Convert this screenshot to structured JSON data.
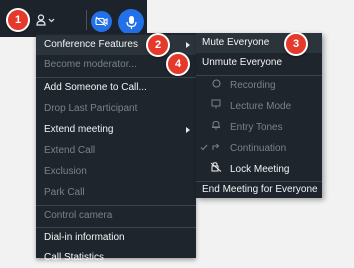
{
  "toolbar": {
    "participants_icon": "person-icon",
    "dropdown_icon": "chevron-down-icon",
    "video_icon": "video-off-icon",
    "mic_icon": "microphone-icon"
  },
  "menu": {
    "items": [
      {
        "label": "Conference Features",
        "disabled": false,
        "submenu": true
      },
      {
        "label": "Become moderator...",
        "disabled": true
      },
      {
        "label": "Add Someone to Call...",
        "disabled": false
      },
      {
        "label": "Drop Last Participant",
        "disabled": true
      },
      {
        "label": "Extend meeting",
        "disabled": false,
        "submenu": true
      },
      {
        "label": "Extend Call",
        "disabled": true
      },
      {
        "label": "Exclusion",
        "disabled": true
      },
      {
        "label": "Park Call",
        "disabled": true
      },
      {
        "label": "Control camera",
        "disabled": true
      },
      {
        "label": "Dial-in information",
        "disabled": false
      },
      {
        "label": "Call Statistics",
        "disabled": false
      }
    ]
  },
  "submenu": {
    "items": [
      {
        "label": "Mute Everyone",
        "disabled": false,
        "icon": ""
      },
      {
        "label": "Unmute Everyone",
        "disabled": false,
        "icon": ""
      },
      {
        "label": "Recording",
        "disabled": true,
        "icon": "record-icon"
      },
      {
        "label": "Lecture Mode",
        "disabled": true,
        "icon": "lecture-icon"
      },
      {
        "label": "Entry Tones",
        "disabled": true,
        "icon": "bell-icon"
      },
      {
        "label": "Continuation",
        "disabled": true,
        "icon": "continuation-icon",
        "checked": true
      },
      {
        "label": "Lock Meeting",
        "disabled": false,
        "icon": "lock-icon"
      },
      {
        "label": "End Meeting for Everyone",
        "disabled": false,
        "icon": ""
      }
    ]
  },
  "badges": [
    "1",
    "2",
    "3",
    "4"
  ],
  "colors": {
    "menu_bg": "#1e252c",
    "accent_blue": "#2371e8",
    "badge_red": "#e5392c",
    "disabled_text": "#7a828a"
  }
}
